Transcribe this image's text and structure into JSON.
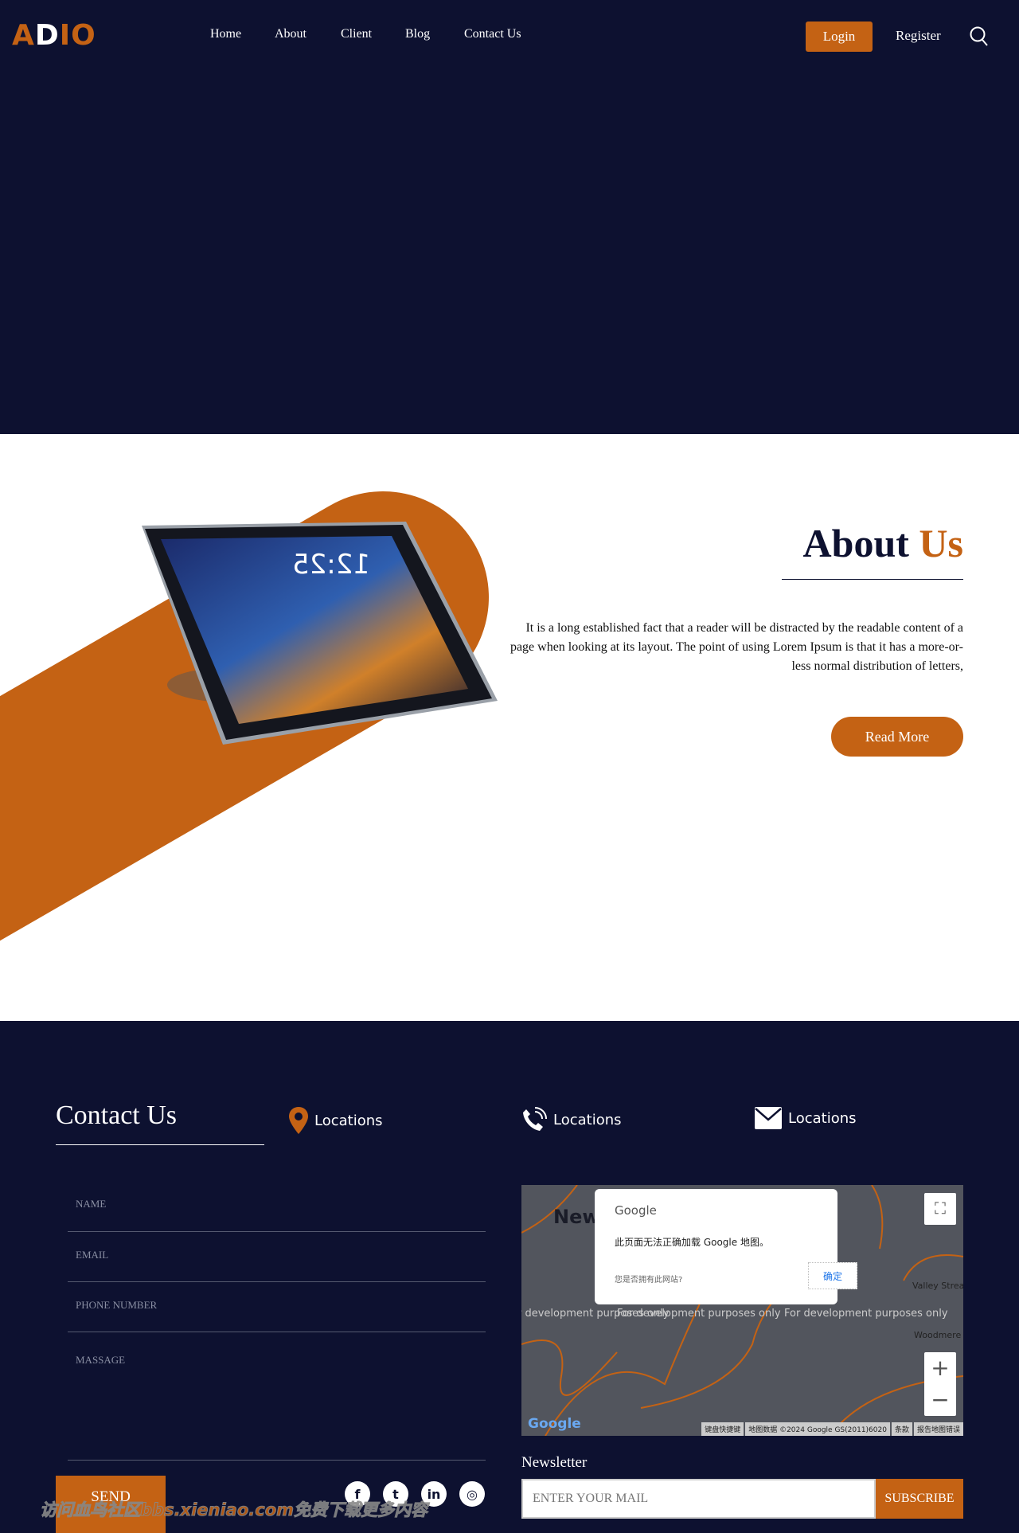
{
  "colors": {
    "dark": "#0d1130",
    "accent": "#c46214"
  },
  "header": {
    "logo_a": "A",
    "logo_d": "D",
    "logo_io": "IO",
    "nav": [
      "Home",
      "About",
      "Client",
      "Blog",
      "Contact Us"
    ],
    "login": "Login",
    "register": "Register",
    "search_icon": "search-icon"
  },
  "about": {
    "title_main": "About",
    "title_accent": "Us",
    "text": "It is a long established fact that a reader will be distracted by the readable content of a page when looking at its layout. The point of using Lorem Ipsum is that it has a more-or-less normal distribution of letters,",
    "read_more": "Read More",
    "tablet_time": "12:25"
  },
  "contact": {
    "title": "Contact Us",
    "info": [
      {
        "icon": "location-pin-icon",
        "label": "Locations"
      },
      {
        "icon": "phone-icon",
        "label": "Locations"
      },
      {
        "icon": "envelope-icon",
        "label": "Locations"
      }
    ],
    "form": {
      "name": "NAME",
      "email": "EMAIL",
      "phone": "PHONE NUMBER",
      "message": "MASSAGE",
      "send": "SEND"
    },
    "social": [
      "facebook-icon",
      "twitter-icon",
      "linkedin-icon",
      "instagram-icon"
    ],
    "map": {
      "dialog_brand": "Google",
      "dialog_message": "此页面无法正确加载 Google 地图。",
      "dialog_question": "您是否拥有此网站?",
      "dialog_ok": "确定",
      "watermark": "For development purposes only",
      "label_new": "New",
      "label_woodmere": "Woodmere",
      "label_valley": "Valley Strea",
      "footer": [
        "键盘快捷键",
        "地图数据 ©2024 Google GS(2011)6020",
        "条款",
        "报告地图错误"
      ],
      "logo": "Google"
    },
    "newsletter": {
      "label": "Newsletter",
      "placeholder": "ENTER YOUR MAIL",
      "subscribe": "SUBSCRIBE"
    },
    "watermark": "访问血鸟社区bbs.xieniao.com免费下载更多内容"
  }
}
